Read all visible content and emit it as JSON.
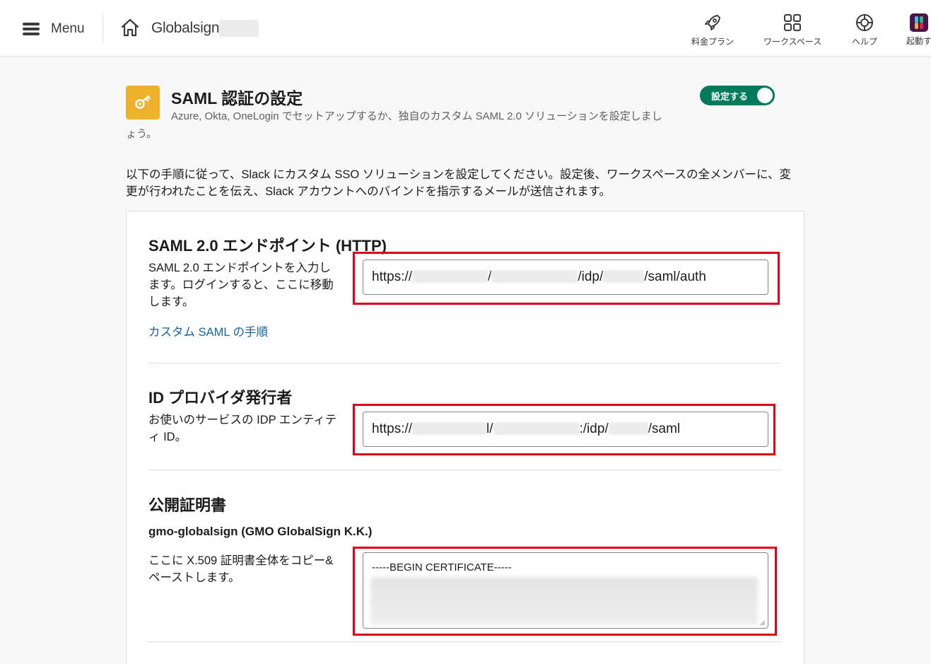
{
  "topbar": {
    "menu_label": "Menu",
    "workspace_name": "Globalsign",
    "nav": [
      {
        "label": "料金プラン",
        "icon": "rocket-icon"
      },
      {
        "label": "ワークスペース",
        "icon": "grid-icon"
      },
      {
        "label": "ヘルプ",
        "icon": "help-lifebuoy-icon"
      },
      {
        "label": "起動す",
        "icon": "slack-logo-icon"
      }
    ]
  },
  "header": {
    "title": "SAML 認証の設定",
    "subtitle": "Azure, Okta, OneLogin でセットアップするか、独自のカスタム SAML 2.0 ソリューションを設定しましょう。",
    "toggle_label": "設定する",
    "toggle_on": true
  },
  "intro": "以下の手順に従って、Slack にカスタム SSO ソリューションを設定してください。設定後、ワークスペースの全メンバーに、変更が行われたことを伝え、Slack アカウントへのバインドを指示するメールが送信されます。",
  "sections": {
    "endpoint": {
      "title": "SAML 2.0 エンドポイント (HTTP)",
      "description": "SAML 2.0 エンドポイントを入力します。ログインすると、ここに移動します。",
      "link": "カスタム SAML の手順",
      "value_parts": [
        "https://",
        "/",
        "/idp/",
        "/saml/auth"
      ]
    },
    "issuer": {
      "title": "ID プロバイダ発行者",
      "description": "お使いのサービスの IDP エンティティ ID。",
      "value_parts": [
        "https://",
        "l/",
        ":/idp/",
        "/saml"
      ]
    },
    "certificate": {
      "title": "公開証明書",
      "issuer_name": "gmo-globalsign (GMO GlobalSign K.K.)",
      "description": "ここに X.509 証明書全体をコピー&ペーストします。",
      "value_head": "-----BEGIN CERTIFICATE-----"
    }
  },
  "colors": {
    "toggle_green": "#007a5a",
    "highlight_red": "#e0001a",
    "link_blue": "#1264a3",
    "icon_yellow": "#ecb22e"
  }
}
